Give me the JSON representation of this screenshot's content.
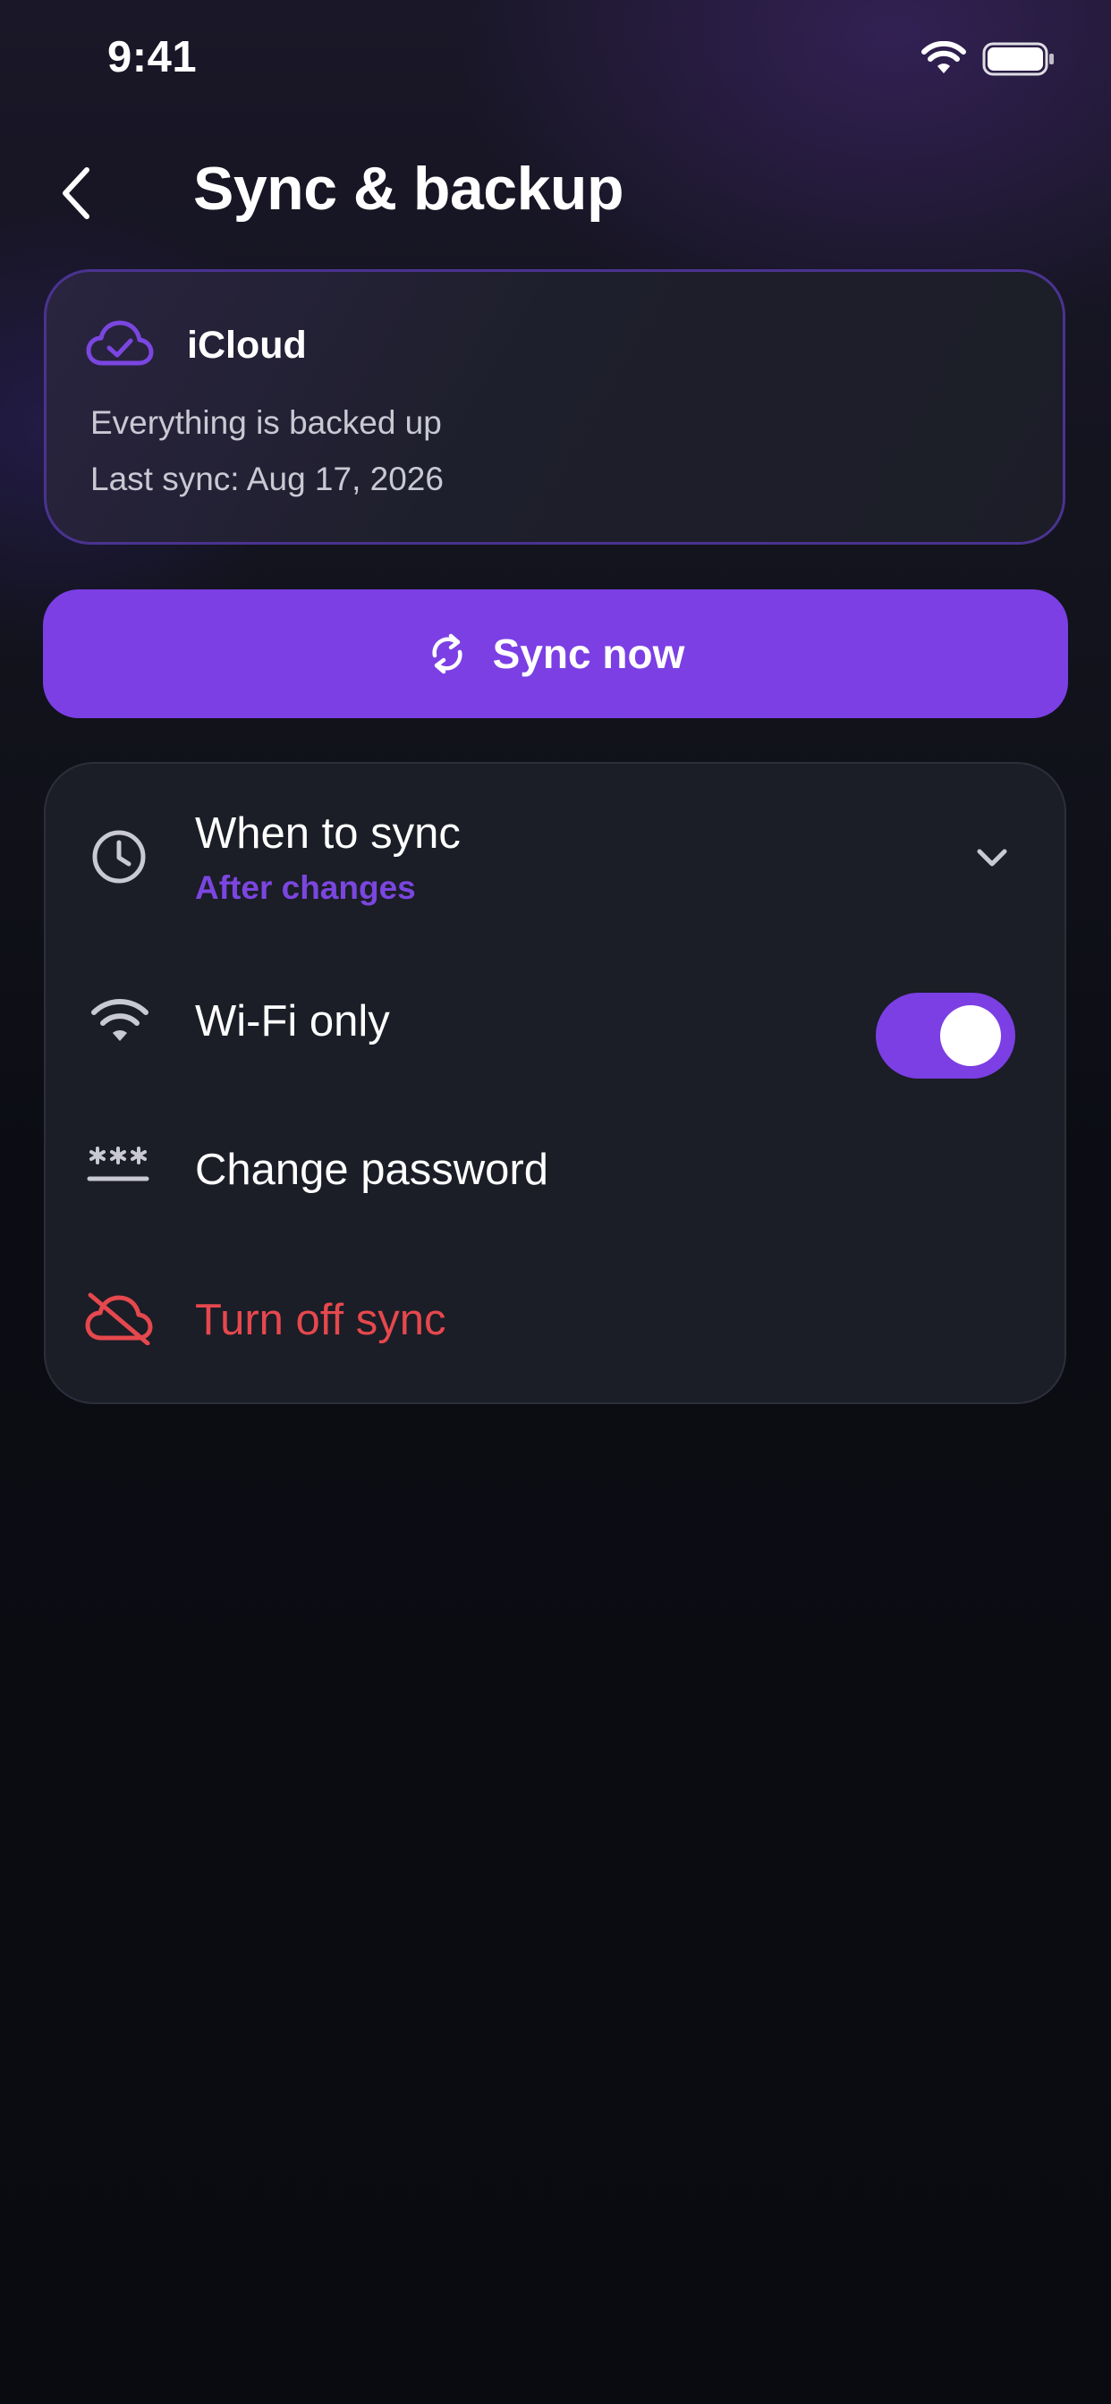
{
  "status_bar": {
    "time": "9:41"
  },
  "header": {
    "title": "Sync & backup",
    "back_icon": "chevron-left-icon"
  },
  "account": {
    "icon": "cloud-check-icon",
    "name": "iCloud",
    "status": "Everything is backed up",
    "last_sync": "Last sync: Aug 17, 2026"
  },
  "sync_button": {
    "icon": "refresh-icon",
    "label": "Sync now"
  },
  "settings": {
    "when_to_sync": {
      "icon": "clock-icon",
      "title": "When to sync",
      "value": "After changes"
    },
    "wifi_only": {
      "icon": "wifi-icon",
      "title": "Wi-Fi only",
      "enabled": true
    },
    "change_password": {
      "icon": "password-icon",
      "title": "Change password"
    },
    "turn_off_sync": {
      "icon": "cloud-off-icon",
      "title": "Turn off sync"
    }
  },
  "colors": {
    "accent": "#7b3fe4",
    "accent_text": "#7b46e0",
    "danger": "#e5484d",
    "card_background": "#1b1d27",
    "screen_background": "#0a0b10"
  }
}
